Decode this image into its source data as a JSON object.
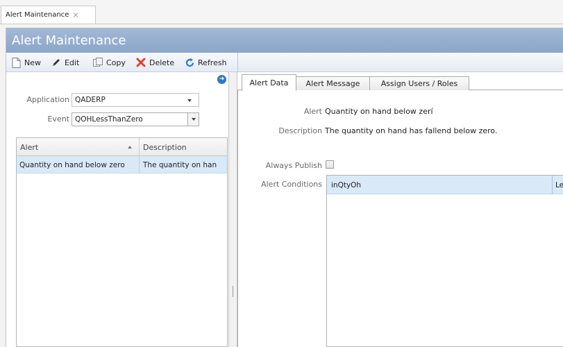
{
  "window_tab": {
    "label": "Alert Maintenance",
    "close_glyph": "×"
  },
  "title": "Alert Maintenance",
  "toolbar": {
    "new_label": "New",
    "edit_label": "Edit",
    "copy_label": "Copy",
    "delete_label": "Delete",
    "refresh_label": "Refresh",
    "icons": [
      "new-document-icon",
      "edit-pencil-icon",
      "copy-icon",
      "delete-x-icon",
      "refresh-icon"
    ]
  },
  "filters": {
    "application_label": "Application",
    "application_value": "QADERP",
    "event_label": "Event",
    "event_value": "QOHLessThanZero"
  },
  "alert_grid": {
    "columns": [
      "Alert",
      "Description"
    ],
    "rows": [
      {
        "alert": "Quantity on hand below zero",
        "description": "The quantity on han"
      }
    ]
  },
  "tabs": [
    "Alert Data",
    "Alert Message",
    "Assign Users / Roles"
  ],
  "alert_data": {
    "alert_label": "Alert",
    "alert_value": "Quantity on hand below zerí",
    "description_label": "Description",
    "description_value": "The quantity on hand has fallend below zero.",
    "always_publish_label": "Always Publish",
    "always_publish_checked": false,
    "alert_conditions_label": "Alert Conditions",
    "conditions_columns": [
      "inQtyOh",
      "Le"
    ]
  },
  "colors": {
    "title_bar": "#8ba6c8",
    "selection": "#d9e9f7",
    "accent_blue": "#2f78c5",
    "delete_red": "#e0412d"
  }
}
